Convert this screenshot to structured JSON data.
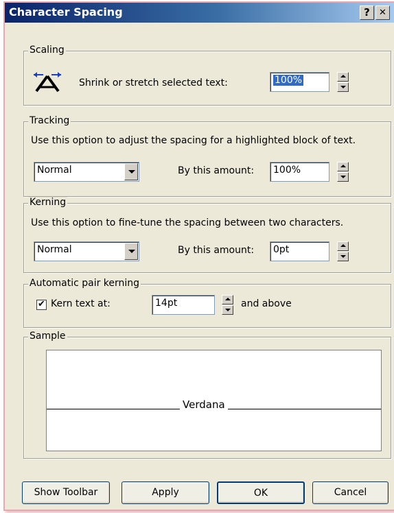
{
  "window": {
    "title": "Character Spacing",
    "help_glyph": "?",
    "close_glyph": "✕"
  },
  "scaling": {
    "legend": "Scaling",
    "label": "Shrink or stretch selected text:",
    "value": "100%"
  },
  "tracking": {
    "legend": "Tracking",
    "description": "Use this option to adjust the spacing for a highlighted block of text.",
    "mode": "Normal",
    "amount_label": "By this amount:",
    "amount": "100%"
  },
  "kerning": {
    "legend": "Kerning",
    "description": "Use this option to fine-tune the spacing between two characters.",
    "mode": "Normal",
    "amount_label": "By this amount:",
    "amount": "0pt"
  },
  "auto_kerning": {
    "legend": "Automatic pair kerning",
    "checkbox_label": "Kern text at:",
    "checked": true,
    "check_glyph": "✔",
    "value": "14pt",
    "suffix": "and above"
  },
  "sample": {
    "legend": "Sample",
    "text": "Verdana"
  },
  "buttons": {
    "show_toolbar": "Show Toolbar",
    "apply": "Apply",
    "ok": "OK",
    "cancel": "Cancel"
  },
  "colors": {
    "titlebar_start": "#0a246a",
    "titlebar_end": "#a6caf0",
    "dialog_bg": "#ece9d8",
    "selection": "#316ac5"
  }
}
